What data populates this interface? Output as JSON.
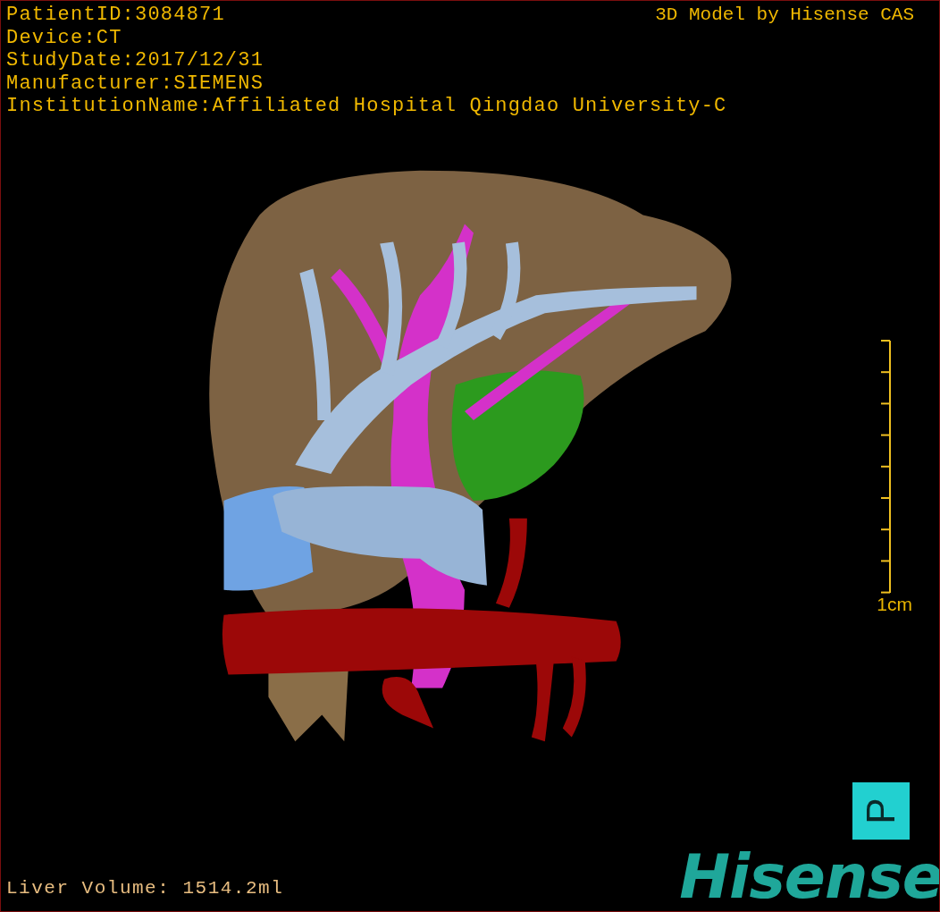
{
  "info_lines": [
    "PatientID:3084871",
    "Device:CT",
    "StudyDate:2017/12/31",
    "Manufacturer:SIEMENS",
    "InstitutionName:Affiliated Hospital Qingdao University-C"
  ],
  "credit": "3D Model by Hisense CAS",
  "scale_bar": {
    "label": "1cm"
  },
  "orientation_marker": {
    "label": "P"
  },
  "liver_volume": "Liver Volume: 1514.2ml",
  "logo": {
    "text": "Hisense"
  }
}
